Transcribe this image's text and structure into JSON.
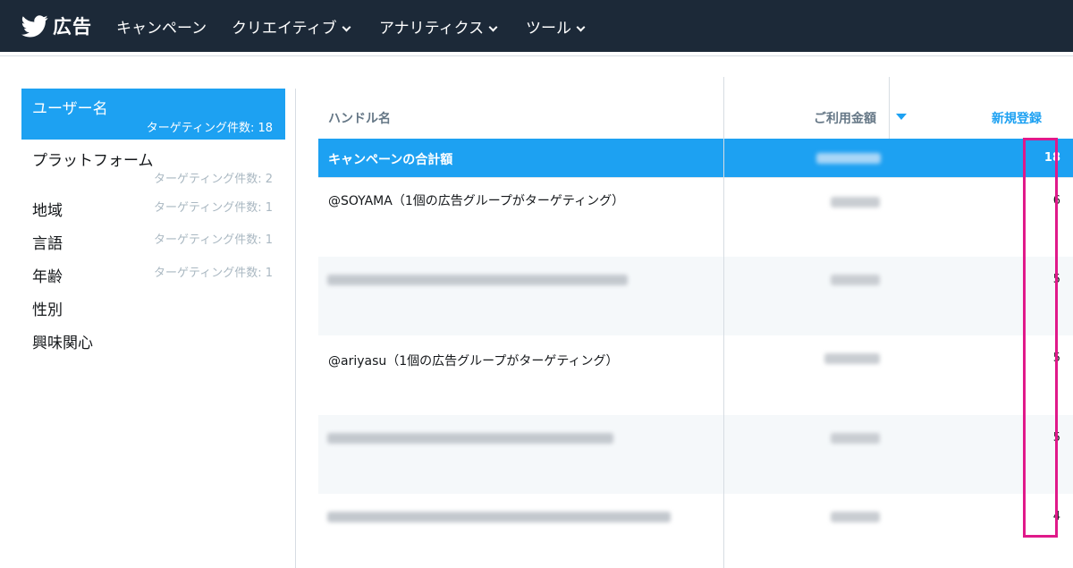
{
  "nav": {
    "brand": "広告",
    "items": [
      {
        "label": "キャンペーン",
        "dropdown": false
      },
      {
        "label": "クリエイティブ",
        "dropdown": true
      },
      {
        "label": "アナリティクス",
        "dropdown": true
      },
      {
        "label": "ツール",
        "dropdown": true
      }
    ]
  },
  "sidebar": {
    "items": [
      {
        "label": "ユーザー名",
        "count": "ターゲティング件数: 18",
        "active": true
      },
      {
        "label": "プラットフォーム",
        "count": "ターゲティング件数: 2"
      },
      {
        "label": "地域",
        "count": "ターゲティング件数: 1"
      },
      {
        "label": "言語",
        "count": "ターゲティング件数: 1"
      },
      {
        "label": "年齢",
        "count": "ターゲティング件数: 1"
      },
      {
        "label": "性別",
        "count": ""
      },
      {
        "label": "興味関心",
        "count": ""
      }
    ]
  },
  "table": {
    "headers": {
      "handle": "ハンドル名",
      "spend": "ご利用金額",
      "signups": "新規登録"
    },
    "total": {
      "label": "キャンペーンの合計額",
      "signups": "18"
    },
    "rows": [
      {
        "handle": "@SOYAMA（1個の広告グループがターゲティング）",
        "signups": "6"
      },
      {
        "handle": "",
        "signups": "5"
      },
      {
        "handle": "@ariyasu（1個の広告グループがターゲティング）",
        "signups": "5"
      },
      {
        "handle": "",
        "signups": "5"
      },
      {
        "handle": "",
        "signups": "4"
      }
    ]
  },
  "colors": {
    "topbar": "#1c2938",
    "accent": "#1da1f2",
    "highlight": "#e0198a"
  }
}
